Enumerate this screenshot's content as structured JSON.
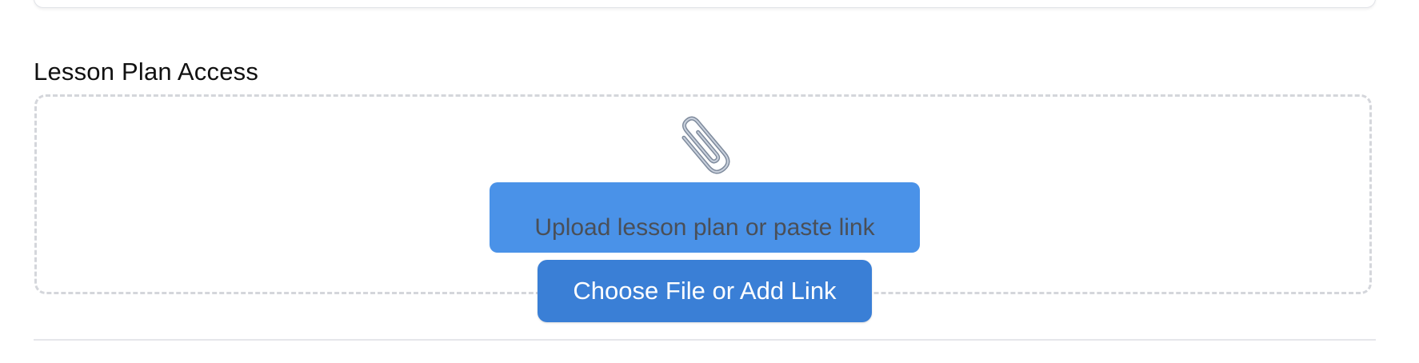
{
  "section": {
    "label": "Lesson Plan Access"
  },
  "dropzone": {
    "icon": "paperclip-icon",
    "prompt_text": "Upload lesson plan or paste link",
    "button_label": "Choose File or Add Link"
  },
  "colors": {
    "prompt_bg": "#4a92e8",
    "button_bg": "#3a7fd6",
    "dashed_border": "#d4d6db"
  }
}
